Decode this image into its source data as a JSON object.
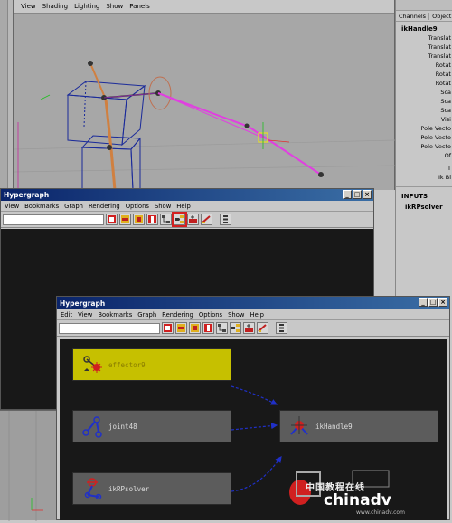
{
  "viewport": {
    "menu": [
      "View",
      "Shading",
      "Lighting",
      "Show",
      "Panels"
    ]
  },
  "channel_box": {
    "tabs": [
      "Channels",
      "Object"
    ],
    "node_name": "ikHandle9",
    "attributes": [
      "Translat",
      "Translat",
      "Translat",
      "Rotat",
      "Rotat",
      "Rotat",
      "Sca",
      "Sca",
      "Sca",
      "Visi",
      "Pole Vecto",
      "Pole Vecto",
      "Pole Vecto",
      "Of",
      "T",
      "Ik Bl"
    ],
    "inputs_heading": "INPUTS",
    "inputs_item": "ikRPsolver"
  },
  "hypergraph_back": {
    "title": "Hypergraph",
    "menu": [
      "View",
      "Bookmarks",
      "Graph",
      "Rendering",
      "Options",
      "Show",
      "Help"
    ],
    "window_buttons": [
      "_",
      "□",
      "×"
    ]
  },
  "hypergraph_front": {
    "title": "Hypergraph",
    "menu": [
      "Edit",
      "View",
      "Bookmarks",
      "Graph",
      "Rendering",
      "Options",
      "Show",
      "Help"
    ],
    "window_buttons": [
      "_",
      "□",
      "×"
    ],
    "nodes": {
      "effector": "effector9",
      "joint": "joint48",
      "ikhandle": "ikHandle9",
      "solver": "ikRPsolver"
    }
  },
  "colors": {
    "selected_node": "#c6c000",
    "node_bg": "#5c5c5c",
    "graph_bg": "#181818",
    "connection": "#2030c8",
    "highlight_box": "#d42020"
  },
  "watermark": {
    "brand": "chinadv",
    "cn_text": "中国教程在线",
    "url": "www.chinadv.com"
  }
}
